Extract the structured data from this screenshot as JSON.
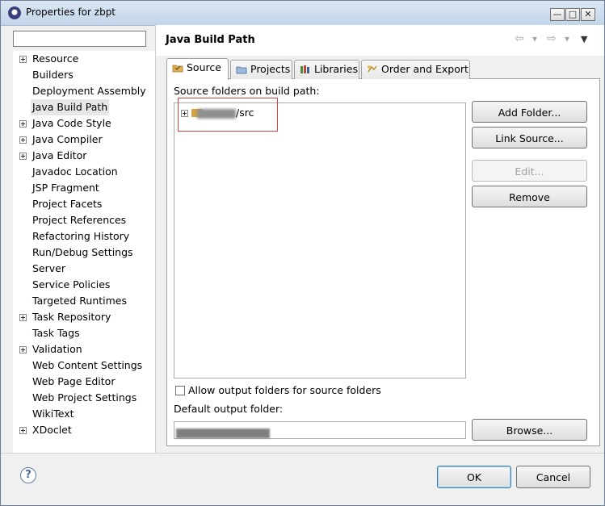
{
  "window": {
    "title": "Properties for zbpt",
    "minimize": "—",
    "maximize": "□",
    "close": "✕"
  },
  "filter": {
    "value": "",
    "placeholder": ""
  },
  "tree": {
    "items": [
      {
        "label": "Resource",
        "expandable": true
      },
      {
        "label": "Builders",
        "expandable": false
      },
      {
        "label": "Deployment Assembly",
        "expandable": false
      },
      {
        "label": "Java Build Path",
        "expandable": false,
        "selected": true
      },
      {
        "label": "Java Code Style",
        "expandable": true
      },
      {
        "label": "Java Compiler",
        "expandable": true
      },
      {
        "label": "Java Editor",
        "expandable": true
      },
      {
        "label": "Javadoc Location",
        "expandable": false
      },
      {
        "label": "JSP Fragment",
        "expandable": false
      },
      {
        "label": "Project Facets",
        "expandable": false
      },
      {
        "label": "Project References",
        "expandable": false
      },
      {
        "label": "Refactoring History",
        "expandable": false
      },
      {
        "label": "Run/Debug Settings",
        "expandable": false
      },
      {
        "label": "Server",
        "expandable": false
      },
      {
        "label": "Service Policies",
        "expandable": false
      },
      {
        "label": "Targeted Runtimes",
        "expandable": false
      },
      {
        "label": "Task Repository",
        "expandable": true
      },
      {
        "label": "Task Tags",
        "expandable": false
      },
      {
        "label": "Validation",
        "expandable": true
      },
      {
        "label": "Web Content Settings",
        "expandable": false
      },
      {
        "label": "Web Page Editor",
        "expandable": false
      },
      {
        "label": "Web Project Settings",
        "expandable": false
      },
      {
        "label": "WikiText",
        "expandable": false
      },
      {
        "label": "XDoclet",
        "expandable": true
      }
    ]
  },
  "page": {
    "title": "Java Build Path",
    "nav": {
      "back": "⇦",
      "back_menu": "▾",
      "forward": "⇨",
      "forward_menu": "▾",
      "view_menu": "▼"
    }
  },
  "tabs": [
    {
      "label": "Source",
      "active": true,
      "icon": "source-folder-icon"
    },
    {
      "label": "Projects",
      "active": false,
      "icon": "projects-icon"
    },
    {
      "label": "Libraries",
      "active": false,
      "icon": "libraries-icon"
    },
    {
      "label": "Order and Export",
      "active": false,
      "icon": "order-export-icon"
    }
  ],
  "source_tab": {
    "list_label": "Source folders on build path:",
    "entries": [
      {
        "path_suffix": "/src"
      }
    ],
    "buttons": {
      "add_folder": "Add Folder...",
      "link_source": "Link Source...",
      "edit": "Edit...",
      "remove": "Remove",
      "browse": "Browse..."
    },
    "allow_output_label": "Allow output folders for source folders",
    "allow_output_checked": false,
    "default_output_label": "Default output folder:"
  },
  "footer": {
    "help": "?",
    "ok": "OK",
    "cancel": "Cancel"
  },
  "colors": {
    "highlight_box": "#d94040",
    "folder": "#d6a23f"
  }
}
